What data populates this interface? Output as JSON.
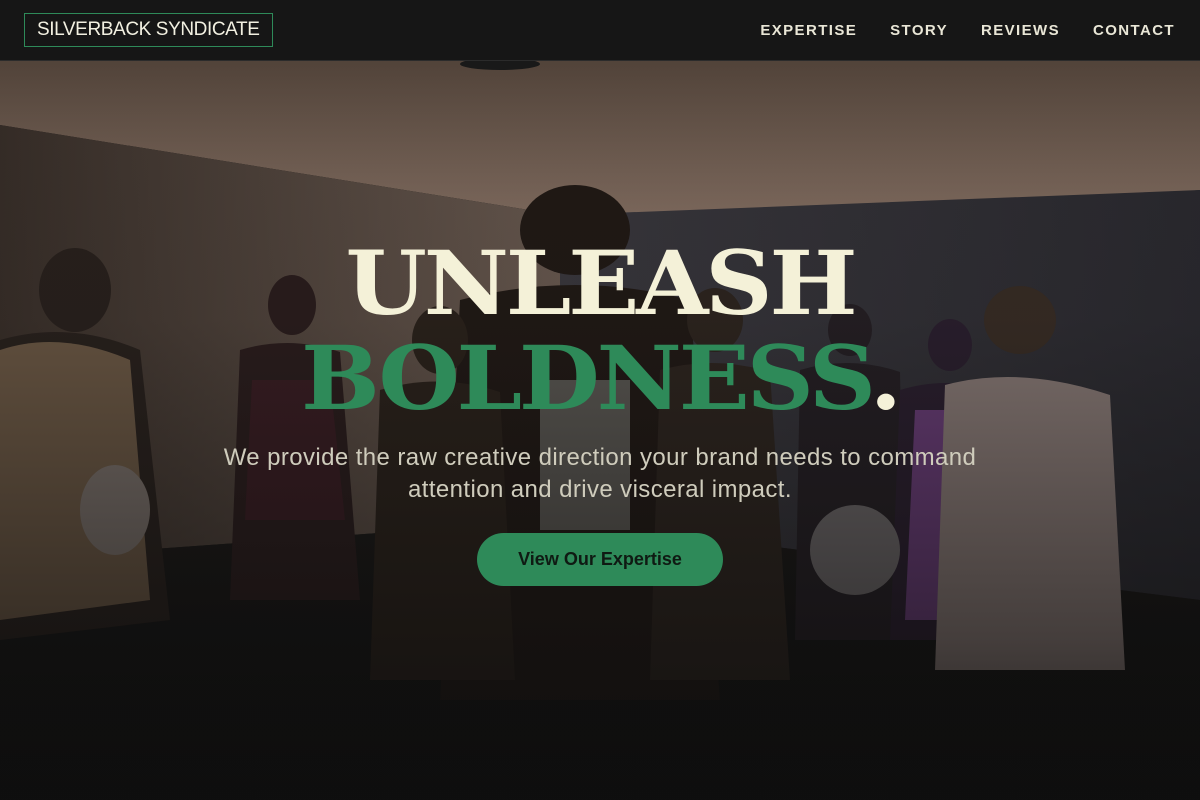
{
  "nav": {
    "brand": "SILVERBACK SYNDICATE",
    "links": [
      {
        "label": "EXPERTISE"
      },
      {
        "label": "STORY"
      },
      {
        "label": "REVIEWS"
      },
      {
        "label": "CONTACT"
      }
    ]
  },
  "hero": {
    "headline_line1": "UNLEASH",
    "headline_line2": "BOLDNESS",
    "headline_punct": ".",
    "tagline": "We provide the raw creative direction your brand needs to command attention and drive visceral impact.",
    "cta_label": "View Our Expertise"
  },
  "colors": {
    "accent": "#2e8a59",
    "headline_light": "#f4f1d8",
    "navbar_bg": "#161616"
  }
}
